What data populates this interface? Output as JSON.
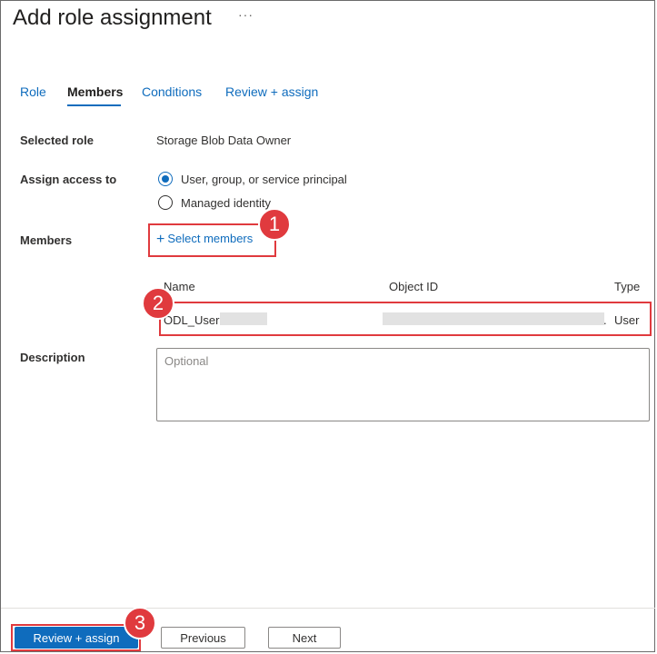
{
  "header": {
    "title": "Add role assignment",
    "more_icon": "ellipsis-icon",
    "more_label": "···"
  },
  "tabs": [
    {
      "label": "Role"
    },
    {
      "label": "Members",
      "active": true
    },
    {
      "label": "Conditions"
    },
    {
      "label": "Review + assign"
    }
  ],
  "form": {
    "selected_role": {
      "label": "Selected role",
      "value": "Storage Blob Data Owner"
    },
    "assign_access": {
      "label": "Assign access to",
      "options": [
        {
          "label": "User, group, or service principal",
          "checked": true
        },
        {
          "label": "Managed identity",
          "checked": false
        }
      ]
    },
    "members": {
      "label": "Members",
      "select_link": "Select members",
      "columns": [
        "Name",
        "Object ID",
        "Type"
      ],
      "rows": [
        {
          "name": "ODL_User",
          "object_id_suffix": ".",
          "type": "User"
        }
      ]
    },
    "description": {
      "label": "Description",
      "placeholder": "Optional"
    }
  },
  "footer": {
    "review_assign": "Review + assign",
    "previous": "Previous",
    "next": "Next"
  },
  "callouts": [
    "1",
    "2",
    "3"
  ],
  "colors": {
    "accent": "#0f6cbd",
    "callout": "#e03a3e"
  }
}
